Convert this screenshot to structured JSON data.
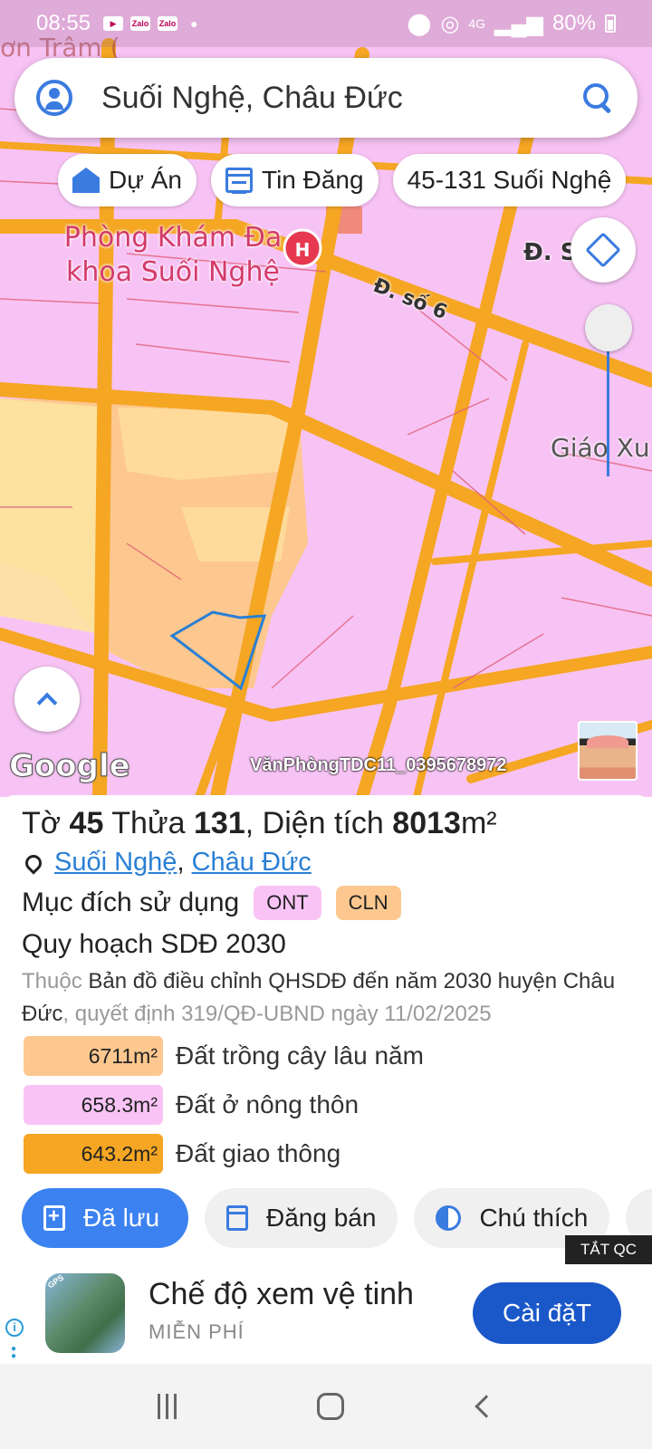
{
  "status_bar": {
    "time": "08:55",
    "notification_icons": [
      "youtube-icon",
      "zalo-icon",
      "zalo-icon"
    ],
    "network": "4G",
    "battery": "80%"
  },
  "map": {
    "faded_label": "ơn Trâm (",
    "poi_label": "Phòng Khám Đa khoa Suối Nghệ",
    "poi_marker": "H",
    "street_label_1": "Đ. số 6",
    "street_label_2": "Đ. S",
    "region_label": "Giáo Xu",
    "google_logo": "Google",
    "watermark": "VănPhòngTDC11_0395678972",
    "colors": {
      "residential_land": "#f7c3f4",
      "perennial_crop_land": "#fdc88f",
      "road": "#f5a623",
      "parcel_outline": "#2a7fd4"
    }
  },
  "search": {
    "query": "Suối Nghệ, Châu Đức"
  },
  "chips": [
    {
      "label": "Dự Án",
      "icon": "house-icon"
    },
    {
      "label": "Tin Đăng",
      "icon": "calendar-icon"
    },
    {
      "label": "45-131 Suối Nghệ"
    }
  ],
  "parcel": {
    "sheet_label": "Tờ",
    "sheet_number": "45",
    "plot_label": "Thửa",
    "plot_number": "131",
    "area_label": "Diện tích",
    "area_value": "8013",
    "area_unit": "m²",
    "ward_link": "Suối Nghệ",
    "district_link": "Châu Đức",
    "purpose_label": "Mục đích sử dụng",
    "purpose_tags": [
      "ONT",
      "CLN"
    ],
    "plan_title": "Quy hoạch SDĐ 2030",
    "plan_prefix": "Thuộc",
    "plan_doc": "Bản đồ điều chỉnh QHSDĐ đến năm 2030 huyện Châu Đức",
    "plan_decision": ", quyết định 319/QĐ-UBND ngày 11/02/2025"
  },
  "land_breakdown": [
    {
      "area": "6711m²",
      "label": "Đất trồng cây lâu năm",
      "color": "#fdc88f"
    },
    {
      "area": "658.3m²",
      "label": "Đất ở nông thôn",
      "color": "#f9c4f5"
    },
    {
      "area": "643.2m²",
      "label": "Đất giao thông",
      "color": "#f5a623"
    }
  ],
  "actions": {
    "saved": "Đã lưu",
    "post_sale": "Đăng bán",
    "legend": "Chú thích"
  },
  "ad": {
    "close_label": "TẮT QC",
    "title": "Chế độ xem vệ tinh",
    "subtitle": "MIỄN PHÍ",
    "install_button": "Cài đặT"
  }
}
